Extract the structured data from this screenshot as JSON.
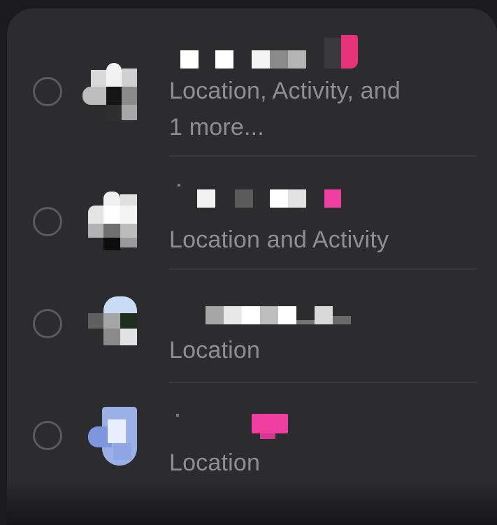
{
  "colors": {
    "background": "#1b1b1d",
    "sheet": "#2c2c2e",
    "secondary_text": "#8e8e93",
    "divider": "#3a3a3d",
    "radio_border": "#5a5a5e"
  },
  "apps": [
    {
      "selected": false,
      "permissions_line1": "Location, Activity, and",
      "permissions_line2": "1 more..."
    },
    {
      "selected": false,
      "permissions_line1": "Location and Activity"
    },
    {
      "selected": false,
      "permissions_line1": "Location"
    },
    {
      "selected": false,
      "permissions_line1": "Location"
    }
  ]
}
